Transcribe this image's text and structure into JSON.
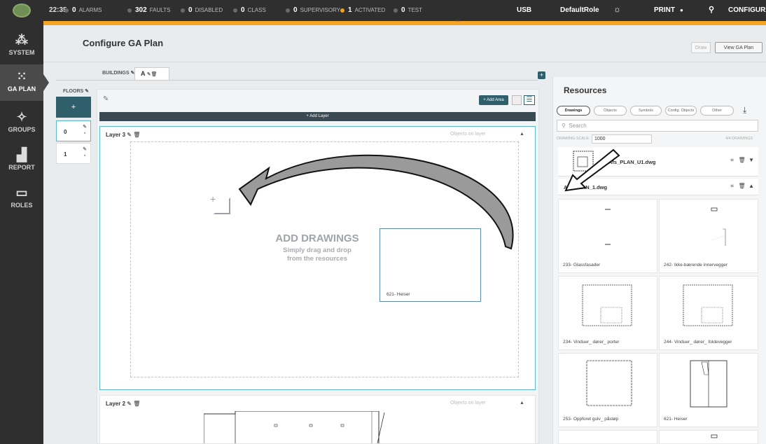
{
  "topbar": {
    "time": "22:35",
    "stats": [
      {
        "num": "0",
        "label": "ALARMS"
      },
      {
        "num": "302",
        "label": "FAULTS"
      },
      {
        "num": "0",
        "label": "DISABLED"
      },
      {
        "num": "0",
        "label": "CLASS"
      },
      {
        "num": "0",
        "label": "SUPERVISORY"
      },
      {
        "num": "1",
        "label": "ACTIVATED"
      },
      {
        "num": "0",
        "label": "TEST"
      }
    ],
    "usb": "USB",
    "role": "DefaultRole",
    "print": "PRINT",
    "configuration": "CONFIGURATION"
  },
  "sidebar": {
    "items": [
      {
        "label": "SYSTEM",
        "icon": "network-icon"
      },
      {
        "label": "GA PLAN",
        "icon": "grid-dots-icon"
      },
      {
        "label": "GROUPS",
        "icon": "groups-icon"
      },
      {
        "label": "REPORT",
        "icon": "chart-icon"
      },
      {
        "label": "ROLES",
        "icon": "monitor-icon"
      }
    ]
  },
  "header": {
    "title": "Configure GA Plan",
    "draw_label": "Draw",
    "view_label": "View GA Plan"
  },
  "buildings": {
    "label": "BUILDINGS",
    "current": "A"
  },
  "floors": {
    "label": "FLOORS",
    "add": "+",
    "items": [
      "0",
      "1"
    ]
  },
  "toolbar": {
    "add_area": "+ Add Area",
    "add_layer": "+ Add Layer"
  },
  "layers": [
    {
      "name": "Layer 3",
      "objects_label": "Objects on layer"
    },
    {
      "name": "Layer 2",
      "objects_label": "Objects on layer"
    }
  ],
  "dropzone": {
    "title": "ADD DRAWINGS",
    "subtitle_line1": "Simply drag and drop",
    "subtitle_line2": "from the resources",
    "dragging_item": "621- Heiser"
  },
  "resources": {
    "title": "Resources",
    "tabs": [
      "Drawings",
      "Objects",
      "Symbols",
      "Config. Objects",
      "Other"
    ],
    "search_placeholder": "Search",
    "scale_label": "DRAWING SCALE:",
    "scale_value": "1000",
    "count": "4/4 DRAWINGS",
    "drawings": [
      {
        "name": "Afs_PLAN_U1.dwg"
      },
      {
        "name": "Afs_PLAN_1.dwg"
      }
    ],
    "cards": [
      "233- Glassfasader",
      "242- Ikke-bærende innervegger",
      "234- Vinduer_ dører_ porter",
      "244- Vinduer_ dører_ foldevegger",
      "253- Oppforet gulv_ påstøp",
      "621- Heiser"
    ]
  },
  "colors": {
    "accent": "#f5a623",
    "teal": "#2f5f6a",
    "selection": "#5bb9c8",
    "bar": "#2f2f2f"
  }
}
